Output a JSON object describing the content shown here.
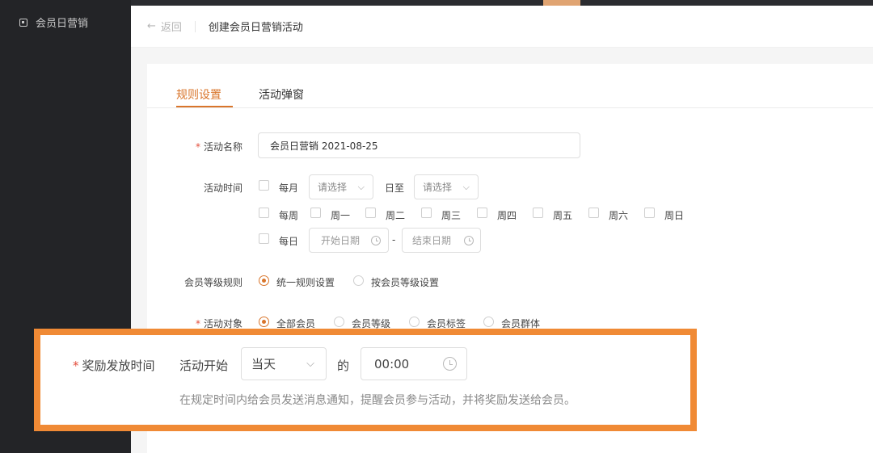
{
  "sidebar": {
    "item_label": "会员日营销"
  },
  "header": {
    "back_label": "返回",
    "title": "创建会员日营销活动"
  },
  "tabs": [
    {
      "label": "规则设置",
      "active": true
    },
    {
      "label": "活动弹窗",
      "active": false
    }
  ],
  "form": {
    "activity_name": {
      "label": "活动名称",
      "value": "会员日营销  2021-08-25",
      "required": true
    },
    "activity_time": {
      "label": "活动时间",
      "monthly": {
        "label": "每月",
        "from_placeholder": "请选择",
        "to_text": "日至",
        "to_placeholder": "请选择"
      },
      "weekly": {
        "label": "每周",
        "days": [
          "周一",
          "周二",
          "周三",
          "周四",
          "周五",
          "周六",
          "周日"
        ]
      },
      "daily": {
        "label": "每日",
        "start_placeholder": "开始日期",
        "separator": "-",
        "end_placeholder": "结束日期"
      }
    },
    "level_rule": {
      "label": "会员等级规则",
      "options": [
        {
          "label": "统一规则设置",
          "selected": true
        },
        {
          "label": "按会员等级设置",
          "selected": false
        }
      ]
    },
    "target": {
      "label": "活动对象",
      "required": true,
      "options": [
        {
          "label": "全部会员",
          "selected": true
        },
        {
          "label": "会员等级",
          "selected": false
        },
        {
          "label": "会员标签",
          "selected": false
        },
        {
          "label": "会员群体",
          "selected": false
        }
      ]
    },
    "reward_time": {
      "label": "奖励发放时间",
      "required": true,
      "prefix": "活动开始",
      "day_value": "当天",
      "connector": "的",
      "time_value": "00:00",
      "hint": "在规定时间内给会员发送消息通知，提醒会员参与活动，并将奖励发送给会员。"
    }
  },
  "colors": {
    "accent": "#d9752b",
    "highlight": "#f08a35",
    "sidebar": "#232427",
    "required": "#e34d3b"
  }
}
